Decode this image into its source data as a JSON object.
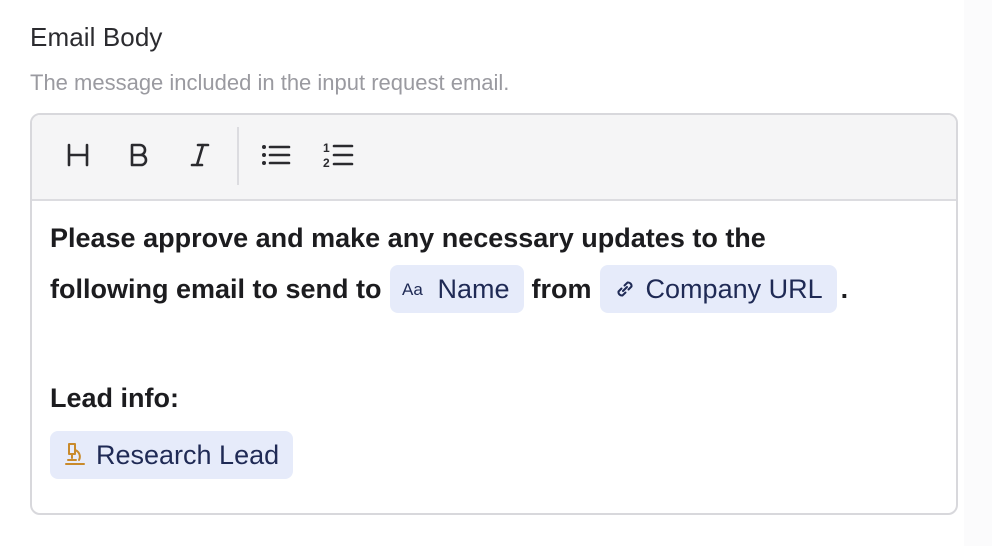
{
  "field": {
    "label": "Email Body",
    "hint": "The message included in the input request email."
  },
  "toolbar": {
    "buttons": [
      {
        "name": "heading",
        "icon": "heading-icon",
        "glyph": "H"
      },
      {
        "name": "bold",
        "icon": "bold-icon",
        "glyph": "B"
      },
      {
        "name": "italic",
        "icon": "italic-icon",
        "glyph": "I"
      },
      {
        "name": "bulleted-list",
        "icon": "bulleted-list-icon"
      },
      {
        "name": "numbered-list",
        "icon": "numbered-list-icon"
      }
    ]
  },
  "body": {
    "line1": "Please approve and make any necessary updates to the",
    "line2_prefix": "following email to send to",
    "pill_name": "Name",
    "pill_name_icon": "text-type-icon",
    "pill_name_icon_text": "Aa",
    "mid_word": "from",
    "pill_company": "Company URL",
    "pill_company_icon": "link-icon",
    "period": ".",
    "lead_heading": "Lead info:",
    "pill_research": "Research Lead",
    "pill_research_icon": "microscope-icon"
  },
  "colors": {
    "pill_bg": "#e6ebfa",
    "pill_text": "#1f2a55",
    "research_icon": "#c98a2b"
  }
}
